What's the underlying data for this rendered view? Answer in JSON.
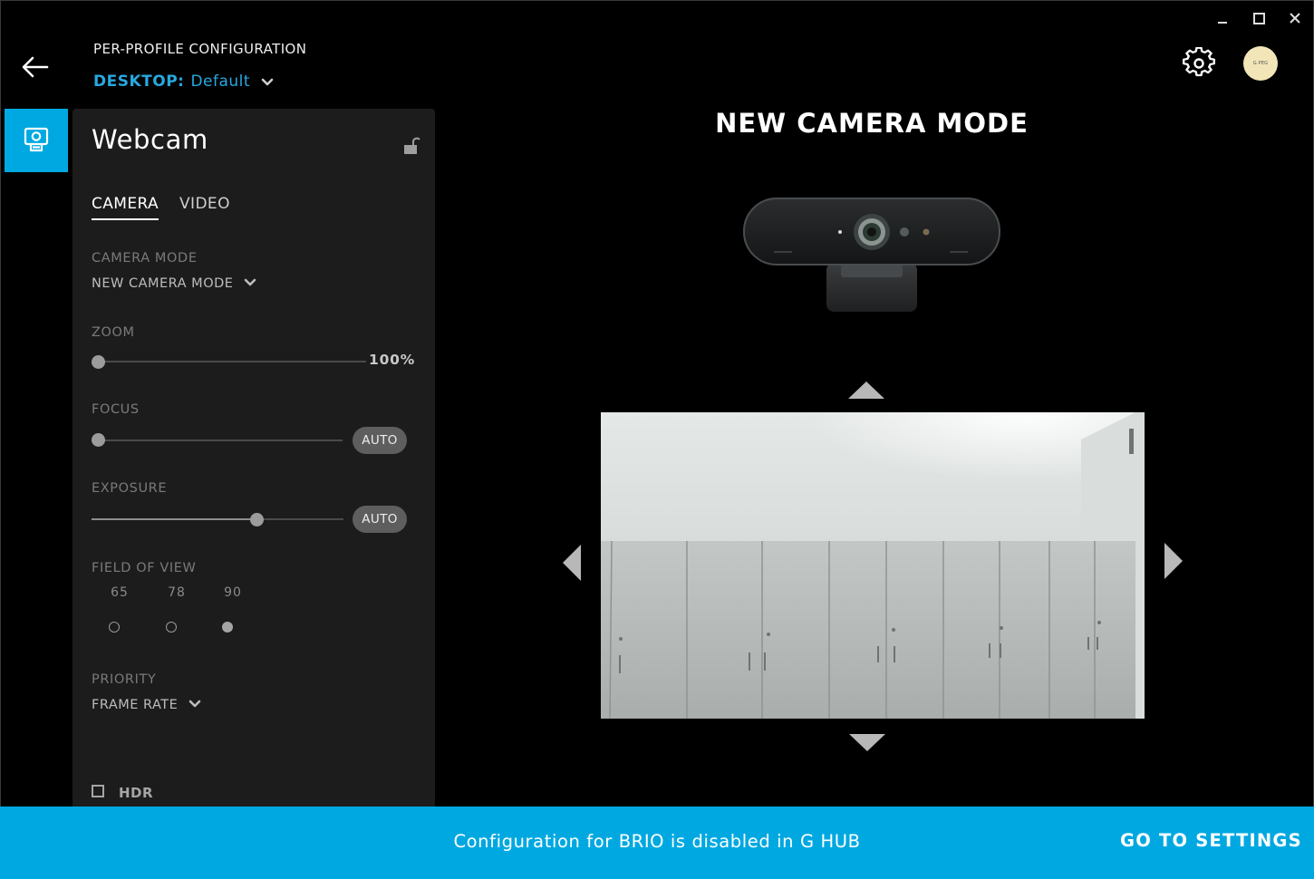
{
  "header": {
    "subtitle": "PER-PROFILE CONFIGURATION",
    "profile_key": "DESKTOP:",
    "profile_value": "Default",
    "avatar_text": "G.PEG"
  },
  "panel": {
    "title": "Webcam",
    "tabs": [
      {
        "label": "CAMERA",
        "active": true
      },
      {
        "label": "VIDEO",
        "active": false
      }
    ],
    "camera_mode": {
      "label": "CAMERA MODE",
      "value": "NEW CAMERA MODE"
    },
    "zoom": {
      "label": "ZOOM",
      "value_text": "100%",
      "level": 0
    },
    "focus": {
      "label": "FOCUS",
      "auto_label": "AUTO",
      "level": 0
    },
    "exposure": {
      "label": "EXPOSURE",
      "auto_label": "AUTO",
      "level": 0.65
    },
    "field_of_view": {
      "label": "FIELD OF VIEW",
      "options": [
        "65",
        "78",
        "90"
      ],
      "selected": "90"
    },
    "priority": {
      "label": "PRIORITY",
      "value": "FRAME RATE"
    },
    "hdr": {
      "label": "HDR",
      "checked": false
    }
  },
  "main": {
    "title": "NEW CAMERA MODE"
  },
  "banner": {
    "message": "Configuration for BRIO is disabled in G HUB",
    "action": "GO TO SETTINGS"
  },
  "colors": {
    "accent": "#00a8e1",
    "panel_bg": "#1c1c1c",
    "background": "#000000"
  },
  "icons": [
    "back-arrow-icon",
    "chevron-down-icon",
    "settings-gear-icon",
    "webcam-icon",
    "unlock-icon",
    "minimize-icon",
    "maximize-icon",
    "close-icon"
  ]
}
